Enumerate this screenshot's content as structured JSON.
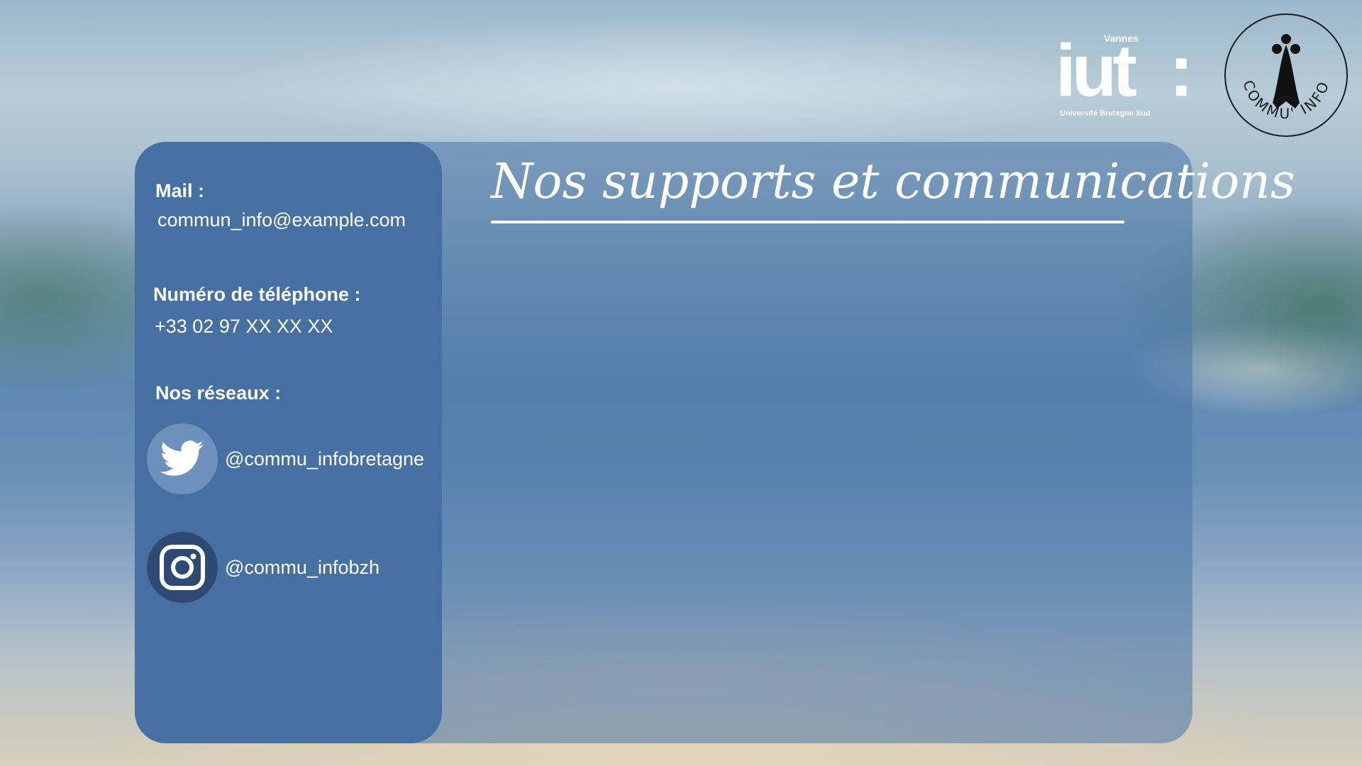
{
  "logos": {
    "iut": {
      "city": "Vannes",
      "word": "iut",
      "colon": ":",
      "university": "Université Bretagne Sud"
    },
    "commu": {
      "ring_text": "COMMU' INFO"
    }
  },
  "sidebar": {
    "mail_label": "Mail :",
    "mail_value": "commun_info@example.com",
    "phone_label": "Numéro de téléphone :",
    "phone_value": "+33 02 97 XX XX XX",
    "networks_label": "Nos réseaux :",
    "socials": [
      {
        "platform": "twitter",
        "icon": "twitter-bird-icon",
        "handle": "@commu_infobretagne"
      },
      {
        "platform": "instagram",
        "icon": "instagram-icon",
        "handle": "@commu_infobzh"
      }
    ]
  },
  "main": {
    "title": "Nos supports et communications"
  },
  "colors": {
    "sidebar": "#4770a2",
    "card": "#4a77a8",
    "twitter_circle": "#6d90bd",
    "instagram_circle": "#2e4a73",
    "text": "#ffffff"
  }
}
